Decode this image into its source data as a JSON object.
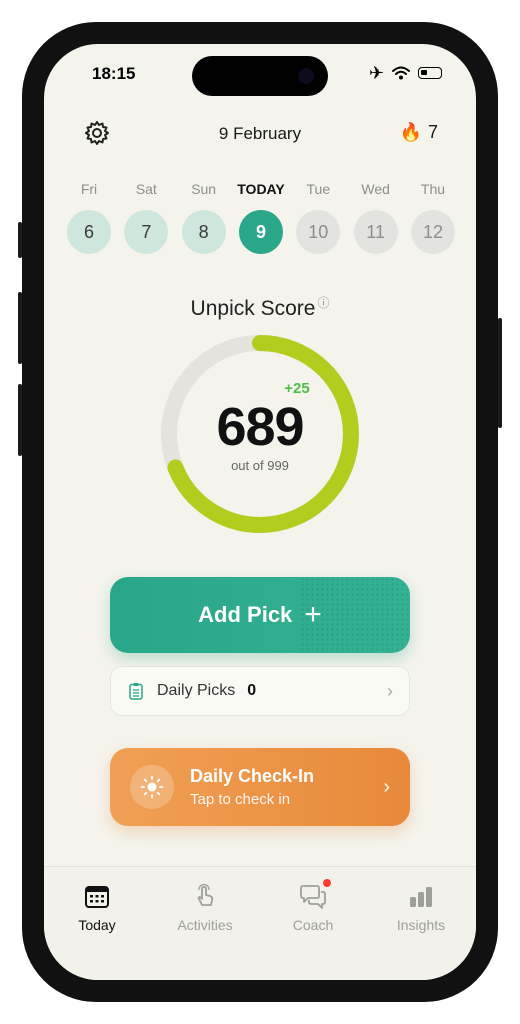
{
  "status": {
    "time": "18:15"
  },
  "header": {
    "date": "9 February",
    "streak": "7"
  },
  "week": [
    {
      "name": "Fri",
      "num": "6",
      "state": "past"
    },
    {
      "name": "Sat",
      "num": "7",
      "state": "past"
    },
    {
      "name": "Sun",
      "num": "8",
      "state": "past"
    },
    {
      "name": "TODAY",
      "num": "9",
      "state": "current"
    },
    {
      "name": "Tue",
      "num": "10",
      "state": "future"
    },
    {
      "name": "Wed",
      "num": "11",
      "state": "future"
    },
    {
      "name": "Thu",
      "num": "12",
      "state": "future"
    }
  ],
  "score": {
    "label": "Unpick Score",
    "value": "689",
    "delta": "+25",
    "subtitle": "out of 999",
    "current": 689,
    "max": 999
  },
  "add_pick": {
    "label": "Add Pick"
  },
  "daily_picks": {
    "label": "Daily Picks",
    "count": "0"
  },
  "checkin": {
    "title": "Daily Check-In",
    "subtitle": "Tap to check in"
  },
  "tabs": [
    {
      "label": "Today",
      "active": true
    },
    {
      "label": "Activities",
      "active": false
    },
    {
      "label": "Coach",
      "active": false
    },
    {
      "label": "Insights",
      "active": false
    }
  ],
  "colors": {
    "accent_green": "#2aa689",
    "gauge_green": "#b4cc1e",
    "delta_green": "#4cbf44",
    "checkin_orange": "#e8893a",
    "background": "#f4f3ec"
  }
}
